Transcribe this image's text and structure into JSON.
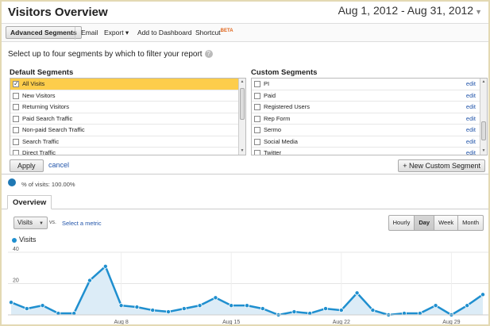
{
  "header": {
    "title": "Visitors Overview",
    "date_range": "Aug 1, 2012 - Aug 31, 2012"
  },
  "toolbar": {
    "advanced_segments": "Advanced Segments",
    "email": "Email",
    "export": "Export ▾",
    "add_to_dashboard": "Add to Dashboard",
    "shortcut": "Shortcut",
    "shortcut_badge": "BETA"
  },
  "segments": {
    "instruction": "Select up to four segments by which to filter your report",
    "default_title": "Default Segments",
    "custom_title": "Custom Segments",
    "default_items": [
      "All Visits",
      "New Visitors",
      "Returning Visitors",
      "Paid Search Traffic",
      "Non-paid Search Traffic",
      "Search Traffic",
      "Direct Traffic"
    ],
    "custom_items": [
      "PI",
      "Paid",
      "Registered Users",
      "Rep Form",
      "Sermo",
      "Social Media",
      "Twitter"
    ],
    "edit_label": "edit",
    "apply": "Apply",
    "cancel": "cancel",
    "new_custom": "+ New Custom Segment"
  },
  "summary": {
    "pct_visits": "% of visits: 100.00%"
  },
  "tabs": {
    "overview": "Overview"
  },
  "controls": {
    "metric": "Visits",
    "vs": "vs.",
    "select_metric": "Select a metric",
    "granularity": [
      "Hourly",
      "Day",
      "Week",
      "Month"
    ],
    "active_granularity": "Day"
  },
  "colors": {
    "series": "#1f8fcf",
    "fill": "#dcecf7",
    "selected_row": "#fdcd4b"
  },
  "chart_data": {
    "type": "area",
    "series": [
      {
        "name": "Visits",
        "values": [
          8,
          4,
          6,
          1,
          1,
          22,
          31,
          6,
          5,
          3,
          2,
          4,
          6,
          11,
          6,
          6,
          4,
          0,
          2,
          1,
          4,
          3,
          14,
          3,
          0,
          1,
          1,
          6,
          0,
          6,
          13
        ]
      }
    ],
    "x_tick_labels": [
      "Aug 8",
      "Aug 15",
      "Aug 22",
      "Aug 29"
    ],
    "x_tick_index": [
      7,
      14,
      21,
      28
    ],
    "y_ticks": [
      20,
      40
    ],
    "ylim": [
      0,
      40
    ],
    "grid": true
  }
}
